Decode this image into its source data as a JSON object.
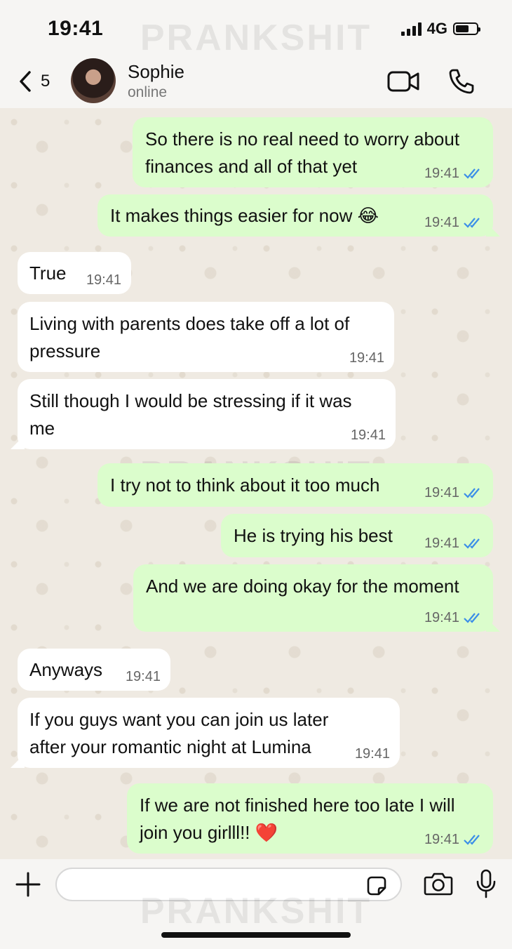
{
  "status_bar": {
    "time": "19:41",
    "network": "4G"
  },
  "watermark": "PRANKSHIT",
  "header": {
    "back_count": "5",
    "contact_name": "Sophie",
    "contact_status": "online"
  },
  "messages": [
    {
      "dir": "out",
      "text": "So there is no real need to worry about\nfinances and all of that yet",
      "time": "19:41",
      "read": true
    },
    {
      "dir": "out",
      "text": "It makes things easier for now 😂",
      "time": "19:41",
      "read": true
    },
    {
      "dir": "in",
      "text": "True",
      "time": "19:41"
    },
    {
      "dir": "in",
      "text": "Living with parents does take off a lot of\npressure",
      "time": "19:41"
    },
    {
      "dir": "in",
      "text": "Still though I would be stressing if it was\nme",
      "time": "19:41"
    },
    {
      "dir": "out",
      "text": "I try not to think about it too much",
      "time": "19:41",
      "read": true
    },
    {
      "dir": "out",
      "text": "He is trying his best",
      "time": "19:41",
      "read": true
    },
    {
      "dir": "out",
      "text": "And we are doing okay for the moment",
      "time": "19:41",
      "read": true
    },
    {
      "dir": "in",
      "text": "Anyways",
      "time": "19:41"
    },
    {
      "dir": "in",
      "text": "If you guys want you can join us later\nafter your romantic night at Lumina",
      "time": "19:41"
    },
    {
      "dir": "out",
      "text": "If we are not finished here too late I will\njoin you girlll!! ❤️",
      "time": "19:41",
      "read": true
    }
  ],
  "input": {
    "placeholder": ""
  },
  "colors": {
    "outgoing_bubble": "#dbfdcc",
    "incoming_bubble": "#ffffff",
    "read_tick": "#3b8ee8"
  },
  "icons": [
    "back-chevron-icon",
    "video-call-icon",
    "phone-icon",
    "plus-icon",
    "sticker-icon",
    "camera-icon",
    "mic-icon"
  ]
}
